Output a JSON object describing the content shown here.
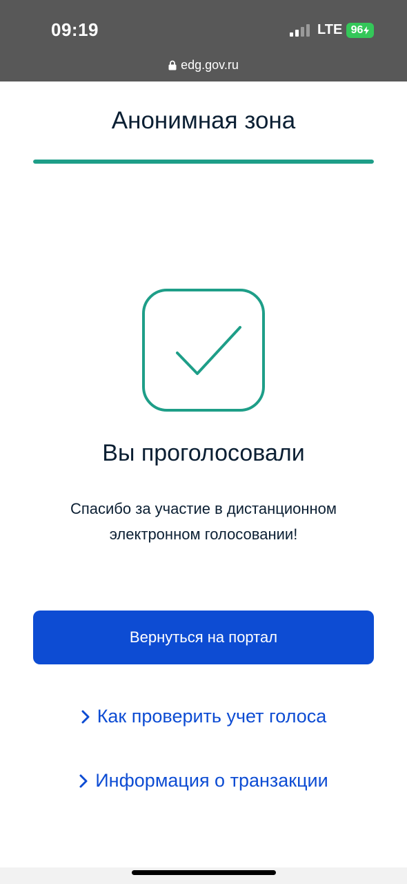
{
  "status_bar": {
    "time": "09:19",
    "network": "LTE",
    "battery": "96",
    "icons": [
      "signal-bars-icon",
      "bolt-icon"
    ]
  },
  "address_bar": {
    "url": "edg.gov.ru",
    "icon": "lock-icon"
  },
  "header": {
    "title": "Анонимная зона"
  },
  "progress": {
    "percent": 100,
    "color": "#1e9e88"
  },
  "result": {
    "icon": "check-icon",
    "title": "Вы проголосовали",
    "message": "Спасибо за участие в дистанционном электронном голосовании!"
  },
  "actions": {
    "portal_button_label": "Вернуться на портал",
    "links": [
      {
        "label": "Как проверить учет голоса",
        "icon": "chevron-right-icon"
      },
      {
        "label": "Информация о транзакции",
        "icon": "chevron-right-icon"
      }
    ]
  },
  "colors": {
    "accent_green": "#1e9e88",
    "primary_blue": "#0d4cd3",
    "text_dark": "#0b1f33",
    "browser_chrome": "#585858",
    "battery_green": "#34c759"
  }
}
